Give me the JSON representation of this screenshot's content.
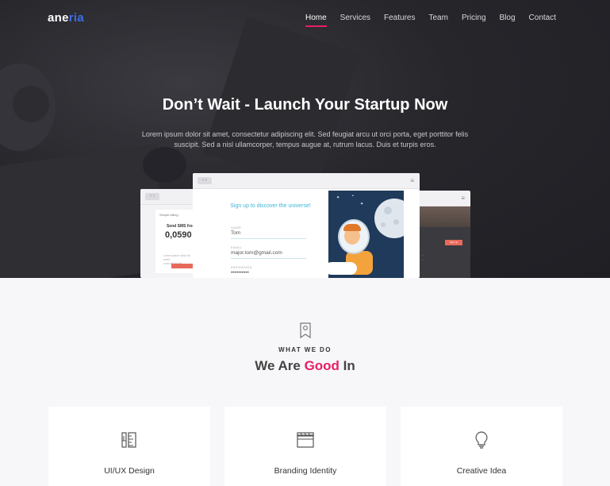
{
  "brand": {
    "logo_main": "ane",
    "logo_accent": "ria",
    "accent_color": "#3d6ee8",
    "highlight_color": "#e91e63"
  },
  "nav": {
    "items": [
      "Home",
      "Services",
      "Features",
      "Team",
      "Pricing",
      "Blog",
      "Contact"
    ],
    "active": "Home"
  },
  "hero": {
    "title": "Don’t Wait - Launch Your Startup Now",
    "text": "Lorem ipsum dolor sit amet, consectetur adipiscing elit. Sed feugiat arcu ut orci porta, eget porttitor felis suscipit. Sed a nisl ullamcorper, tempus augue at, rutrum lacus. Duis et turpis eros."
  },
  "mockups": {
    "left": {
      "header": "Simple billing",
      "title": "Send SMS from",
      "amount": "0,0590",
      "lines": "Lorem ipsum dolor sit amet\ncons adipis elit",
      "button": "Register"
    },
    "main": {
      "form_title": "Sign up to discover the universe!",
      "name_label": "NAME",
      "name_value": "Tom",
      "email_label": "EMAIL",
      "email_value": "major.tom@gmail.com",
      "password_label": "PASSWORD",
      "password_value": "••••••••••"
    },
    "right": {
      "button": "Sign up"
    }
  },
  "services": {
    "subtitle": "WHAT WE DO",
    "title_pre": "We Are ",
    "title_hl": "Good",
    "title_post": " In",
    "cards": [
      {
        "icon": "ruler-pencil-icon",
        "label": "UI/UX Design"
      },
      {
        "icon": "clapperboard-icon",
        "label": "Branding Identity"
      },
      {
        "icon": "lightbulb-icon",
        "label": "Creative Idea"
      }
    ]
  }
}
